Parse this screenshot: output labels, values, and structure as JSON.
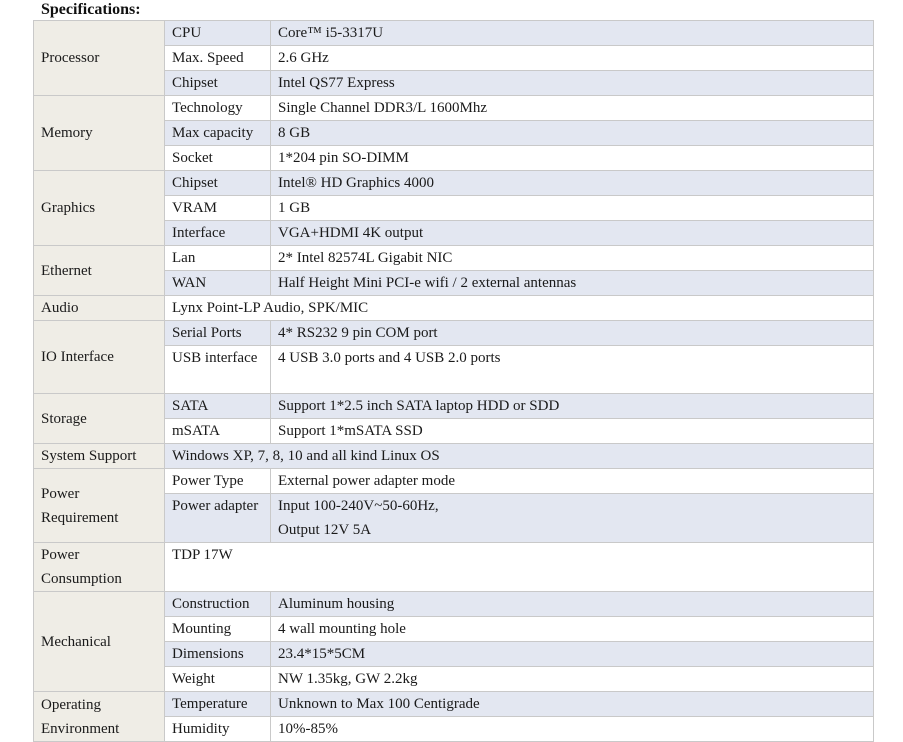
{
  "heading": "Specifications:",
  "rows": [
    {
      "cat": "Processor",
      "span": 3,
      "sub": "CPU",
      "val": "Core™ i5-3317U",
      "shade": true
    },
    {
      "sub": "Max. Speed",
      "val": "2.6 GHz",
      "shade": false
    },
    {
      "sub": "Chipset",
      "val": "Intel QS77 Express",
      "shade": true
    },
    {
      "cat": "Memory",
      "span": 3,
      "sub": "Technology",
      "val": "Single Channel DDR3/L 1600Mhz",
      "shade": false
    },
    {
      "sub": "Max capacity",
      "val": "8 GB",
      "shade": true
    },
    {
      "sub": "Socket",
      "val": "1*204 pin SO-DIMM",
      "shade": false
    },
    {
      "cat": "Graphics",
      "span": 3,
      "sub": "Chipset",
      "val": "Intel® HD Graphics 4000",
      "shade": true
    },
    {
      "sub": "VRAM",
      "val": "1 GB",
      "shade": false
    },
    {
      "sub": "Interface",
      "val": "VGA+HDMI 4K output",
      "shade": true
    },
    {
      "cat": "Ethernet",
      "span": 2,
      "sub": "Lan",
      "val": "2* Intel 82574L Gigabit NIC",
      "shade": false
    },
    {
      "sub": "WAN",
      "val": "Half Height Mini PCI-e wifi / 2 external antennas",
      "shade": true
    },
    {
      "cat": "Audio",
      "span": 1,
      "merged": true,
      "val": "Lynx Point-LP Audio, SPK/MIC",
      "shade": false
    },
    {
      "cat": "IO Interface",
      "span": 2,
      "sub": "Serial Ports",
      "val": "4* RS232 9 pin COM port",
      "shade": true
    },
    {
      "sub": "USB interface",
      "val": "4 USB 3.0 ports and 4 USB 2.0 ports",
      "shade": false,
      "tall": true
    },
    {
      "cat": "Storage",
      "span": 2,
      "sub": "SATA",
      "val": "Support 1*2.5 inch SATA laptop HDD or SDD",
      "shade": true
    },
    {
      "sub": "mSATA",
      "val": "Support 1*mSATA SSD",
      "shade": false
    },
    {
      "cat": "System Support",
      "span": 1,
      "merged": true,
      "val": "Windows XP, 7, 8, 10 and all kind Linux OS",
      "shade": true
    },
    {
      "cat": "Power Requirement",
      "span": 2,
      "sub": "Power Type",
      "val": "External power adapter mode",
      "shade": false
    },
    {
      "sub": "Power adapter",
      "val": "Input 100-240V~50-60Hz,\nOutput 12V 5A",
      "shade": true,
      "tall": true
    },
    {
      "cat": "Power Consumption",
      "span": 1,
      "merged": true,
      "val": "TDP 17W",
      "shade": false,
      "tall": true
    },
    {
      "cat": "Mechanical",
      "span": 4,
      "sub": "Construction",
      "val": "Aluminum housing",
      "shade": true
    },
    {
      "sub": "Mounting",
      "val": "4 wall mounting hole",
      "shade": false
    },
    {
      "sub": "Dimensions",
      "val": "23.4*15*5CM",
      "shade": true
    },
    {
      "sub": "Weight",
      "val": "NW 1.35kg, GW 2.2kg",
      "shade": false
    },
    {
      "cat": "Operating Environment",
      "span": 2,
      "sub": "Temperature",
      "val": "Unknown to Max 100 Centigrade",
      "shade": true
    },
    {
      "sub": "Humidity",
      "val": "10%-85%",
      "shade": false
    }
  ]
}
